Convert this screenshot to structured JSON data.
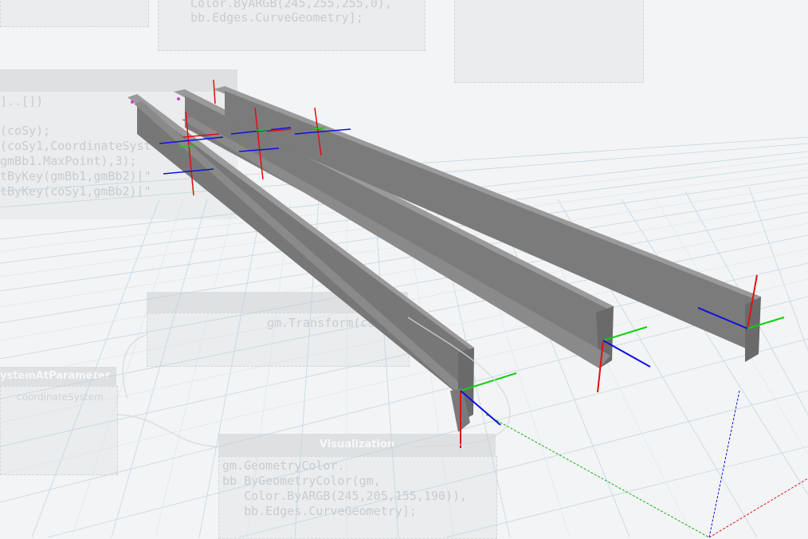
{
  "canvas": {
    "background": "#f3f4f5",
    "grid_color": "#b9d2e0",
    "beam_color": "#8a8a8a",
    "axis_colors": {
      "x": "#e01010",
      "y": "#10d010",
      "z": "#1010e0"
    }
  },
  "nodes": {
    "top_node": {
      "line1": "Color.ByARGB(245,255,255,0),",
      "line2": "bb.Edges.CurveGeometry];"
    },
    "code_block": {
      "lines": [
        "]..[])",
        "",
        "(coSy);",
        "(coSy1,CoordinateSyst",
        "gmBb1.MaxPoint),3);",
        "tByKey(gmBb1,gmBb2)[\"",
        "tByKey(coSy1,gmBb2)[\""
      ]
    },
    "center_node": {
      "header": "",
      "code": "gm.Transform(cs);"
    },
    "left_node": {
      "header": "ystemAtParameter",
      "port": "coordinateSystem"
    },
    "visualization_node": {
      "header": "Visualization",
      "lines": [
        "gm.GeometryColor.",
        "bb ByGeometryColor(gm,",
        "   Color.ByARGB(245,205,155,190)),",
        "   bb.Edges.CurveGeometry];"
      ]
    }
  }
}
